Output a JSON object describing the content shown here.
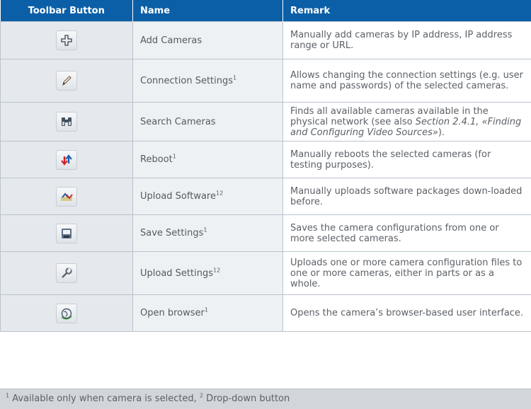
{
  "table": {
    "headers": [
      "Toolbar Button",
      "Name",
      "Remark"
    ],
    "rows": [
      {
        "icon": "add-icon",
        "name": "Add Cameras",
        "name_sup": "",
        "remark": "Manually add cameras by IP address, IP address range or URL."
      },
      {
        "icon": "pencil-icon",
        "name": "Connection Settings",
        "name_sup": "1",
        "remark": "Allows changing the connection settings (e.g. user name and passwords) of the selected cameras."
      },
      {
        "icon": "binoculars-icon",
        "name": "Search Cameras",
        "name_sup": "",
        "remark_pre": "Finds all available cameras available in the physical network (see also ",
        "remark_em": "Section 2.4.1, «Finding and Configuring Video Sources»",
        "remark_post": ")."
      },
      {
        "icon": "reboot-icon",
        "name": "Reboot",
        "name_sup": "1",
        "remark": "Manually reboots the selected cameras (for testing purposes)."
      },
      {
        "icon": "upload-software-icon",
        "name": "Upload Software",
        "name_sup": "12",
        "remark": "Manually uploads software packages down-loaded before."
      },
      {
        "icon": "save-icon",
        "name": "Save Settings",
        "name_sup": "1",
        "remark": "Saves the camera configurations from one or more selected cameras."
      },
      {
        "icon": "wrench-icon",
        "name": "Upload Settings",
        "name_sup": "12",
        "remark": "Uploads one or more camera configuration files to one or more cameras, either in parts or as a whole."
      },
      {
        "icon": "browser-icon",
        "name": "Open browser",
        "name_sup": "1",
        "remark": "Opens the camera’s browser-based user interface."
      }
    ]
  },
  "footer": {
    "sup1": "1",
    "text1": " Available only when camera is selected, ",
    "sup2": "2",
    "text2": " Drop-down button"
  },
  "colors": {
    "header_bg": "#0b5fa6",
    "icon_col_bg": "#e5e9ee",
    "footer_bg": "#d2d6db"
  }
}
